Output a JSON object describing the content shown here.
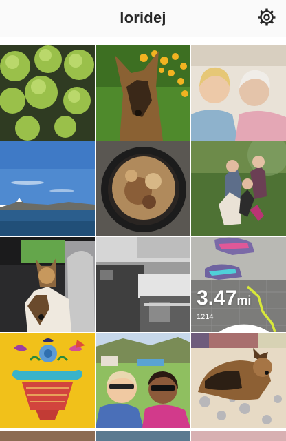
{
  "header": {
    "username": "loridej",
    "settings_icon": "gear-icon"
  },
  "grid": {
    "photos": [
      {
        "subject": "green spiky seed pods"
      },
      {
        "subject": "german shepherd dog with yellow flowers"
      },
      {
        "subject": "two women selfie"
      },
      {
        "subject": "lake with blue sky and mountains"
      },
      {
        "subject": "cast iron skillet dish"
      },
      {
        "subject": "children with dog on lawn"
      },
      {
        "subject": "dogs in car back seat"
      },
      {
        "subject": "black and white camper interior"
      },
      {
        "subject": "run tracker with sneakers"
      },
      {
        "subject": "quilt flower vase applique"
      },
      {
        "subject": "two women smiling outdoors"
      },
      {
        "subject": "dog lying on blanket"
      }
    ],
    "run_stats": {
      "distance": "3.47",
      "unit": "mi",
      "calories": "1214"
    }
  }
}
